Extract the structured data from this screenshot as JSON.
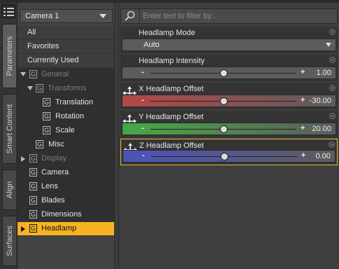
{
  "tabs": [
    "Parameters",
    "Smart Content",
    "Align",
    "Surfaces"
  ],
  "node_select": {
    "value": "Camera 1"
  },
  "tree": {
    "items": [
      {
        "label": "All"
      },
      {
        "label": "Favorites"
      },
      {
        "label": "Currently Used"
      },
      {
        "label": "General"
      },
      {
        "label": "Transforms"
      },
      {
        "label": "Translation"
      },
      {
        "label": "Rotation"
      },
      {
        "label": "Scale"
      },
      {
        "label": "Misc"
      },
      {
        "label": "Display"
      },
      {
        "label": "Camera"
      },
      {
        "label": "Lens"
      },
      {
        "label": "Blades"
      },
      {
        "label": "Dimensions"
      },
      {
        "label": "Headlamp"
      }
    ],
    "group_glyph": "G"
  },
  "filter": {
    "placeholder": "Enter text to filter by..."
  },
  "params": [
    {
      "label": "Headlamp Mode",
      "value": "Auto"
    },
    {
      "label": "Headlamp Intensity",
      "value": "1.00",
      "level": 0.5
    },
    {
      "label": "X Headlamp Offset",
      "value": "-30.00",
      "level": 0.5,
      "color": "#b04848"
    },
    {
      "label": "Y Headlamp Offset",
      "value": "20.00",
      "level": 0.5,
      "color": "#47a447"
    },
    {
      "label": "Z Headlamp Offset",
      "value": "0.00",
      "level": 0.5,
      "color": "#4e54b4"
    }
  ],
  "slider_symbols": {
    "minus": "-",
    "plus": "+"
  },
  "colors": {
    "selected": "#f6b324",
    "accent_border": "#e8bb3a"
  }
}
